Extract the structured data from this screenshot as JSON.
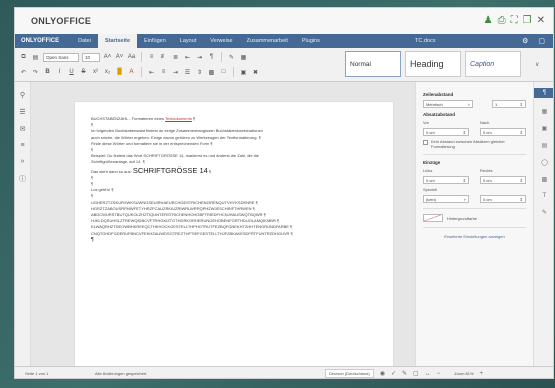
{
  "window": {
    "title": "ONLYOFFICE",
    "title_icons": [
      "user-icon",
      "print-icon",
      "fullscreen-icon",
      "restore-icon",
      "close-icon"
    ]
  },
  "menubar": {
    "brand": "ONLYOFFICE",
    "tabs": [
      {
        "label": "Datei",
        "active": false
      },
      {
        "label": "Startseite",
        "active": true
      },
      {
        "label": "Einfügen",
        "active": false
      },
      {
        "label": "Layout",
        "active": false
      },
      {
        "label": "Verweise",
        "active": false
      },
      {
        "label": "Zusammenarbeit",
        "active": false
      },
      {
        "label": "Plugins",
        "active": false
      }
    ],
    "document_name": "TC.docx",
    "right_icons": [
      "settings-icon",
      "expand-icon"
    ]
  },
  "toolbar": {
    "font_name": "Open Sans",
    "font_size": "10",
    "styles": [
      {
        "label": "Normal",
        "selected": true
      },
      {
        "label": "Heading",
        "selected": false
      },
      {
        "label": "Caption",
        "selected": false
      }
    ]
  },
  "document": {
    "lines": [
      {
        "text": "BUCHSTABENZAHL - Formatieren eines ",
        "link": "Textdokuments",
        "suffix": " ¶"
      },
      {
        "text": "¶"
      },
      {
        "text": "Im folgenden Buchstabensalat findest du einige Zusammenhanglosen Buchstabenkombinationen"
      },
      {
        "text": "auch solche, die Wörter ergeben. Einige davon gehören zu Werkzeugen der Textformatierung. ¶"
      },
      {
        "text": "Finde diese Wörter und formatiere sie in der entsprechenden Form ¶"
      },
      {
        "text": "¶"
      },
      {
        "text": "Beispiel: Du findest das Wort SCHRIFTGRÖSSE 14, markierst es und änderst die Zahl, die die"
      },
      {
        "text": "Schriftgrößenanlage, auf 14. ¶"
      },
      {
        "text": "Das sieht dann so aus: ",
        "big": "SCHRIFTGRÖSSE 14",
        "suffix": " ¶"
      },
      {
        "text": "¶"
      },
      {
        "text": "¶"
      },
      {
        "text": "Los geht's! ¶"
      },
      {
        "text": "¶"
      },
      {
        "text": "UGHERZTZSKURXWKSUWNGSEUIRHAEURCHGESTRICHENZIRENQUTVHYKSDENRE ¶"
      },
      {
        "text": "HGRZTZABOUSRFMWFETYHRZFCAUZRKIUZRIWRLWRRQPHZWJESCHRIFTHRWEN ¶"
      },
      {
        "text": "ABDCWURSTBUTQUKOLZHZTIQUNTERSTRICHENHOHGBFTRIEDFHCNJHAUSWQTBQWR ¶"
      },
      {
        "text": "HJKLDQSUHSLZTREWQIDBCVFTRHGKIZTGTHDRKORHERUNGEHOBENFGRTHDUOLAMQIKMBR ¶"
      },
      {
        "text": "KLWAQRHZTDEOWBHKREEQCTHKHOCKGESTELLTHPHOTRUTFEZBQFGNEKHTZHHTENGRUNDFARBE ¶"
      },
      {
        "text": "CNQTOHDFGDERUFBNCVFEKHZAUWDSGTREZTHFTIEFGESTELLTHJFZBKAKESDFRTFUHTRZDHGUVR ¶"
      },
      {
        "text": "¶",
        "cursor": true
      }
    ]
  },
  "paragraph_panel": {
    "line_spacing_title": "Zeilenabstand",
    "line_spacing_mode": "Mehrfach",
    "line_spacing_value": "1",
    "paragraph_spacing_title": "Absatzabstand",
    "before_label": "Vor",
    "after_label": "Nach",
    "before_value": "0 cm",
    "after_value": "0 cm",
    "no_spacing_label": "Kein Abstand zwischen Absätzen gleicher Formatierung",
    "indents_title": "Einzüge",
    "left_label": "Links",
    "right_label": "Rechts",
    "left_value": "0 cm",
    "right_value": "0 cm",
    "special_label": "Speziell",
    "special_mode": "(kein)",
    "special_value": "0 cm",
    "background_label": "Hintergrundfarbe",
    "advanced_link": "Erweiterte Einstellungen anzeigen"
  },
  "statusbar": {
    "page_count": "Seite 1 von 1",
    "save_state": "Alle Änderungen gespeichert",
    "language": "Deutsch (Deutschland)",
    "zoom": "Zoom 81%"
  }
}
